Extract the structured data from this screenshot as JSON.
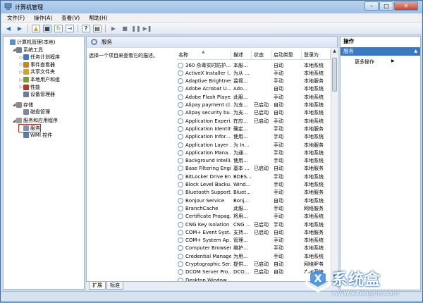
{
  "window": {
    "title": "计算机管理"
  },
  "menu": [
    "文件(F)",
    "操作(A)",
    "查看(V)",
    "帮助(H)"
  ],
  "tree": [
    {
      "label": "计算机管理(本地)",
      "level": 0,
      "twisty": ""
    },
    {
      "label": "系统工具",
      "level": 1,
      "twisty": "◢"
    },
    {
      "label": "任务计划程序",
      "level": 2,
      "twisty": "▷"
    },
    {
      "label": "事件查看器",
      "level": 2,
      "twisty": "▷"
    },
    {
      "label": "共享文件夹",
      "level": 2,
      "twisty": "▷"
    },
    {
      "label": "本地用户和组",
      "level": 2,
      "twisty": "▷"
    },
    {
      "label": "性能",
      "level": 2,
      "twisty": "▷"
    },
    {
      "label": "设备管理器",
      "level": 2,
      "twisty": ""
    },
    {
      "label": "存储",
      "level": 1,
      "twisty": "◢"
    },
    {
      "label": "磁盘管理",
      "level": 2,
      "twisty": ""
    },
    {
      "label": "服务和应用程序",
      "level": 1,
      "twisty": "◢"
    },
    {
      "label": "服务",
      "level": 2,
      "twisty": "",
      "selected": true
    },
    {
      "label": "WMI 控件",
      "level": 2,
      "twisty": ""
    }
  ],
  "center": {
    "header": "服务",
    "description": "选择一个项目来查看它的描述。",
    "columns": [
      "名称",
      "描述",
      "状态",
      "启动类型",
      "登录为"
    ],
    "rows": [
      [
        "360 杀毒实时防护...",
        "本服...",
        "",
        "自动",
        "本地系统"
      ],
      [
        "ActiveX Installer (...",
        "为从 ...",
        "",
        "手动",
        "本地系统"
      ],
      [
        "Adaptive Brightness",
        "监视...",
        "",
        "手动",
        "本地服务"
      ],
      [
        "Adobe Acrobat U...",
        "Ado...",
        "",
        "自动",
        "本地系统"
      ],
      [
        "Adobe Flash Playe...",
        "此服...",
        "",
        "手动",
        "本地系统"
      ],
      [
        "Alipay payment cl...",
        "为支...",
        "已启动",
        "自动",
        "本地系统"
      ],
      [
        "Alipay security bu...",
        "为支...",
        "已启动",
        "自动",
        "本地系统"
      ],
      [
        "Application Experi...",
        "在应...",
        "已启动",
        "手动",
        "本地系统"
      ],
      [
        "Application Identity",
        "确定...",
        "",
        "手动",
        "本地服务"
      ],
      [
        "Application Infor...",
        "使用...",
        "",
        "手动",
        "本地系统"
      ],
      [
        "Application Layer ...",
        "为 In...",
        "",
        "手动",
        "本地服务"
      ],
      [
        "Application Mana...",
        "为通...",
        "",
        "手动",
        "本地系统"
      ],
      [
        "Background Intelli...",
        "使用...",
        "",
        "手动",
        "本地系统"
      ],
      [
        "Base Filtering Engi...",
        "基本 ...",
        "已启动",
        "自动",
        "本地服务"
      ],
      [
        "BitLocker Drive En...",
        "BDES...",
        "",
        "手动",
        "本地系统"
      ],
      [
        "Block Level Backu...",
        "Wind...",
        "",
        "手动",
        "本地系统"
      ],
      [
        "Bluetooth Support...",
        "Bluet...",
        "",
        "手动",
        "本地服务"
      ],
      [
        "Bonjour Service",
        "Bonj...",
        "",
        "自动",
        "本地系统"
      ],
      [
        "BranchCache",
        "此服...",
        "",
        "手动",
        "网络服务"
      ],
      [
        "Certificate Propag...",
        "将用...",
        "",
        "手动",
        "本地系统"
      ],
      [
        "CNG Key Isolation",
        "CNG ...",
        "已启动",
        "手动",
        "本地系统"
      ],
      [
        "COM+ Event Syst...",
        "支持...",
        "已启动",
        "自动",
        "本地服务"
      ],
      [
        "COM+ System Ap...",
        "管理...",
        "",
        "手动",
        "本地系统"
      ],
      [
        "Computer Browser",
        "维护...",
        "",
        "手动",
        "本地系统"
      ],
      [
        "Credential Manager",
        "为用...",
        "",
        "手动",
        "本地系统"
      ],
      [
        "Cryptographic Ser...",
        "提供...",
        "已启动",
        "自动",
        "网络服务"
      ],
      [
        "DCOM Server Pro...",
        "DCO...",
        "已启动",
        "自动",
        "本地系统"
      ],
      [
        "Desktop Window...",
        "...",
        "",
        "",
        ""
      ]
    ]
  },
  "tabs": [
    "扩展",
    "标准"
  ],
  "actions": {
    "title": "操作",
    "group": "服务",
    "item": "更多操作"
  },
  "watermark": {
    "text": "系统盒",
    "url": "www.xitonghe.com"
  },
  "colors": {
    "selection_outline": "#d0231b",
    "actions_header": "#3b78c4"
  }
}
